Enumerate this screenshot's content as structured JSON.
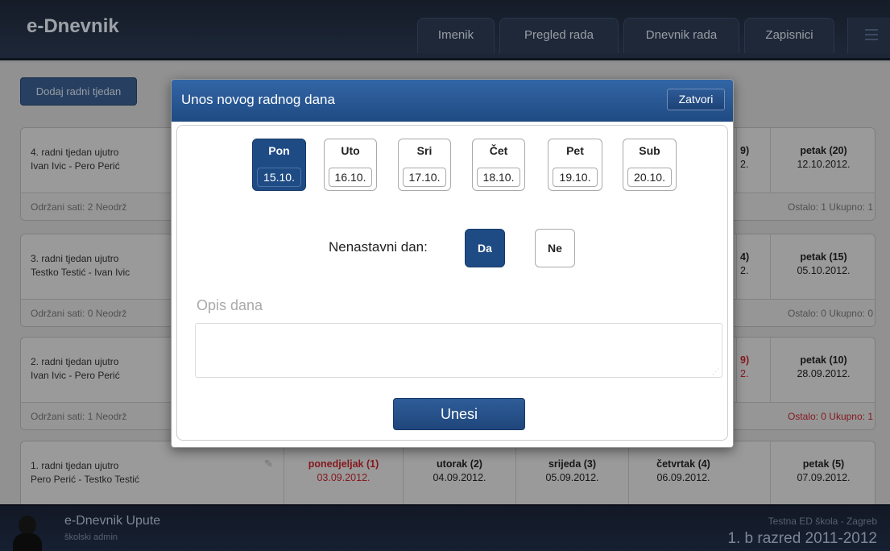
{
  "app": {
    "title": "e-Dnevnik"
  },
  "nav": [
    "Imenik",
    "Pregled rada",
    "Dnevnik rada",
    "Zapisnici"
  ],
  "main": {
    "add_week": "Dodaj radni tjedan"
  },
  "weeks": [
    {
      "title": "4. radni tjedan ujutro",
      "teachers": "Ivan Ivic - Pero Perić",
      "stats": "Održani sati: 2    Neodrž",
      "stats_right": "Ostalo: 1    Ukupno: 1",
      "thu": "9)",
      "thu_date": "2.",
      "fri": "petak (20)",
      "fri_date": "12.10.2012."
    },
    {
      "title": "3. radni tjedan ujutro",
      "teachers": "Testko Testić - Ivan Ivic",
      "stats": "Održani sati: 0    Neodrž",
      "stats_right": "Ostalo: 0    Ukupno: 0",
      "thu": "4)",
      "thu_date": "2.",
      "fri": "petak (15)",
      "fri_date": "05.10.2012."
    },
    {
      "title": "2. radni tjedan ujutro",
      "teachers": "Ivan Ivic - Pero Perić",
      "stats": "Održani sati: 1    Neodrž",
      "stats_right": "Ostalo: 0    Ukupno: 1",
      "thu": "9)",
      "thu_date": "2.",
      "fri": "petak (10)",
      "fri_date": "28.09.2012."
    },
    {
      "title": "1. radni tjedan ujutro",
      "teachers": "Pero Perić - Testko Testić",
      "days": [
        {
          "name": "ponedjeljak (1)",
          "date": "03.09.2012."
        },
        {
          "name": "utorak (2)",
          "date": "04.09.2012."
        },
        {
          "name": "srijeda (3)",
          "date": "05.09.2012."
        },
        {
          "name": "četvrtak (4)",
          "date": "06.09.2012."
        },
        {
          "name": "petak (5)",
          "date": "07.09.2012."
        }
      ]
    }
  ],
  "footer": {
    "name": "e-Dnevnik Upute",
    "role": "školski admin",
    "school": "Testna ED škola - Zagreb",
    "class": "1. b razred 2011-2012"
  },
  "dialog": {
    "title": "Unos novog radnog dana",
    "close": "Zatvori",
    "days": [
      {
        "name": "Pon",
        "date": "15.10."
      },
      {
        "name": "Uto",
        "date": "16.10."
      },
      {
        "name": "Sri",
        "date": "17.10."
      },
      {
        "name": "Čet",
        "date": "18.10."
      },
      {
        "name": "Pet",
        "date": "19.10."
      },
      {
        "name": "Sub",
        "date": "20.10."
      }
    ],
    "selected_day": "Pon",
    "non_teaching_label": "Nenastavni dan:",
    "yes": "Da",
    "no": "Ne",
    "non_teaching_selected": "Da",
    "description_label": "Opis dana",
    "description_value": "",
    "submit": "Unesi"
  },
  "colors": {
    "primary": "#1f4b85",
    "header": "#2c3a52",
    "alert": "#c4262e"
  }
}
